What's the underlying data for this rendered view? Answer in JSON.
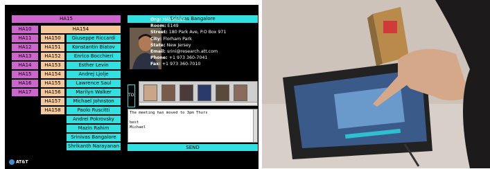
{
  "tree": {
    "root": "HA15",
    "level1": [
      "HA10",
      "HA11",
      "HA12",
      "HA13",
      "HA14",
      "HA15",
      "HA16",
      "HA17"
    ],
    "selected_parent": "HA154",
    "level2": [
      "HA150",
      "HA151",
      "HA152",
      "HA153",
      "HA154",
      "HA155",
      "HA156",
      "HA157",
      "HA158"
    ],
    "people": [
      "Giuseppe Riccardi",
      "Konstantin Biatov",
      "Enrico Bocchieri",
      "Esther Levin",
      "Andrej Ljolje",
      "Lawrence Saul",
      "Marilyn Walker",
      "Michael Johnston",
      "Paolo Ruscitti",
      "Andrei Pokrovsky",
      "Mazin Rahim",
      "Srinivas Bangalore",
      "Shrikanth Narayanan"
    ]
  },
  "contact": {
    "header": "Srinivas Bangalore",
    "fields": [
      {
        "label": "Org:",
        "value": "HA154000"
      },
      {
        "label": "Room:",
        "value": "E149"
      },
      {
        "label": "Street:",
        "value": "180 Park Ave, P.O Box 971"
      },
      {
        "label": "City:",
        "value": "Florham Park"
      },
      {
        "label": "State:",
        "value": "New Jersey"
      },
      {
        "label": "Email:",
        "value": "srini@research.att.com"
      },
      {
        "label": "Phone:",
        "value": "+1 973 360-7041"
      },
      {
        "label": "Fax:",
        "value": "+1 973 360-7010"
      }
    ]
  },
  "compose": {
    "to_label": "TO:",
    "message": "The meeting has moved to 3pm Thurs\n\nbest\nMichael",
    "send_label": "SEND"
  },
  "brand": {
    "logo_text": "AT&T"
  },
  "colors": {
    "background": "#000000",
    "root": "#cc66cc",
    "level2": "#f5c89a",
    "person": "#33e0e0"
  }
}
